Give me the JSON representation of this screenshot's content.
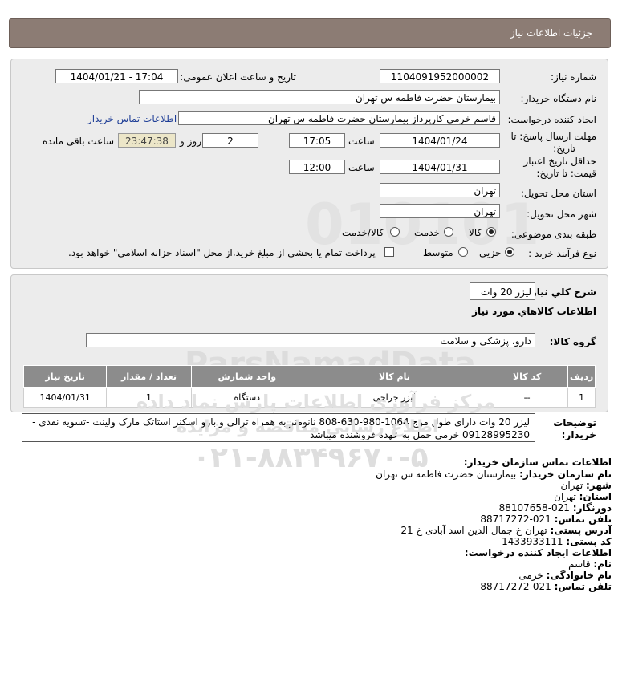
{
  "header": {
    "title": "جزئیات اطلاعات نیاز"
  },
  "fields": {
    "need_number_label": "شماره نیاز:",
    "need_number": "1104091952000002",
    "announce_label": "تاریخ و ساعت اعلان عمومی:",
    "announce_value": "1404/01/21 - 17:04",
    "buyer_org_label": "نام دستگاه خریدار:",
    "buyer_org": "بیمارستان حضرت فاطمه س  تهران",
    "creator_label": "ایجاد کننده درخواست:",
    "creator": "قاسم خرمی کارپرداز بیمارستان حضرت فاطمه س  تهران",
    "buyer_contact_link": "اطلاعات تماس خریدار",
    "deadline_label_1": "مهلت ارسال پاسخ: تا",
    "deadline_label_2": "تاریخ:",
    "deadline_date": "1404/01/24",
    "time_label": "ساعت",
    "deadline_time": "17:05",
    "days_value": "2",
    "days_label": "روز و",
    "timer": "23:47:38",
    "remaining_label": "ساعت باقی مانده",
    "validity_label_1": "حداقل تاریخ اعتبار",
    "validity_label_2": "قیمت: تا تاریخ:",
    "validity_date": "1404/01/31",
    "validity_time_label": "ساعت",
    "validity_time": "12:00",
    "province_label": "استان محل تحویل:",
    "province": "تهران",
    "city_label": "شهر محل تحویل:",
    "city": "تهران",
    "category_label": "طبقه بندی موضوعی:",
    "category_options": [
      "کالا",
      "خدمت",
      "کالا/خدمت"
    ],
    "process_label": "نوع فرآیند خرید :",
    "process_options": [
      "جزیی",
      "متوسط"
    ],
    "payment_note": "پرداخت تمام یا بخشی از مبلغ خرید،از محل \"اسناد خزانه اسلامی\" خواهد بود."
  },
  "summary": {
    "label": "شرح کلي نياز:",
    "value": "لیزر 20 وات",
    "goods_info_title": "اطلاعات کالاهاي مورد نياز",
    "group_label": "گروه کالا:",
    "group_value": "دارو، پزشکی و سلامت"
  },
  "table": {
    "headers": [
      "ردیف",
      "کد کالا",
      "نام کالا",
      "واحد شمارش",
      "تعداد / مقدار",
      "تاریخ نیاز"
    ],
    "rows": [
      [
        "1",
        "--",
        "لیزر جراحی",
        "دستگاه",
        "1",
        "1404/01/31"
      ]
    ]
  },
  "buyer_notes": {
    "label_1": "توضیحات",
    "label_2": "خریدار:",
    "line_1": "لیزر 20 وات دارای طول موج 1064-980-630-808 نانومتر به همراه ترالی و بازو اسکنر استاتک مارک ولینت -تسویه نقدی -",
    "line_2": "09128995230 خرمی حمل به عهده فروشنده میباشد"
  },
  "contact": {
    "title": "اطلاعات تماس سازمان خریدار:",
    "org_name_label": "نام سازمان خریدار:",
    "org_name": "بیمارستان حضرت فاطمه س تهران",
    "city_label": "شهر:",
    "city": "تهران",
    "province_label": "استان:",
    "province": "تهران",
    "fax_label": "دورنگار:",
    "fax": "021-88107658",
    "phone_label": "تلفن تماس:",
    "phone": "021-88717272",
    "address_label": "آدرس پستی:",
    "address": "تهران خ جمال الدین اسد آبادی خ 21",
    "postal_label": "کد پستی:",
    "postal": "1433933111",
    "creator_title": "اطلاعات ایجاد کننده درخواست:",
    "first_name_label": "نام:",
    "first_name": "قاسم",
    "last_name_label": "نام خانوادگی:",
    "last_name": "خرمی",
    "creator_phone_label": "تلفن تماس:",
    "creator_phone": "021-88717272"
  },
  "watermark": {
    "line_1": "ParsNamadData",
    "line_2": "مرکز فرآوری اطلاعات پارس نماد داده",
    "line_3": "اطلاع رسانی مناقصه و مزایده",
    "line_4": "۰۲۱-۸۸۳۴۹۶۷۰-۵"
  },
  "colors": {
    "header_bg": "#8c7c74",
    "panel_bg": "#ececec",
    "table_header_bg": "#8c8c8c",
    "timer_bg": "#ece6c8",
    "link": "#1d3d96"
  }
}
